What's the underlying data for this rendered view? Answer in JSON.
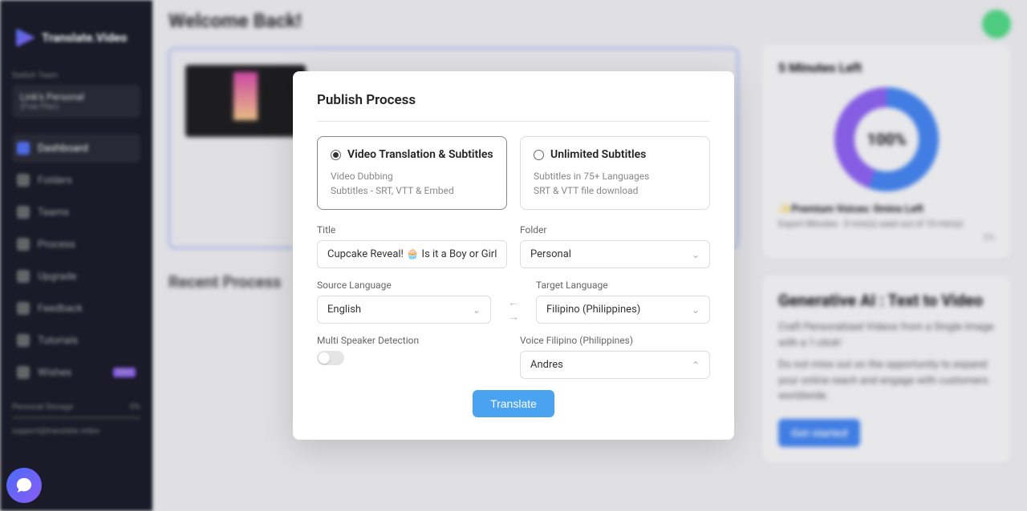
{
  "app": {
    "name": "Translate.Video"
  },
  "sidebar": {
    "switch_label": "Switch Team",
    "team_name": "Link's Personal",
    "team_plan": "(Free Plan)",
    "nav": [
      {
        "label": "Dashboard"
      },
      {
        "label": "Folders"
      },
      {
        "label": "Teams"
      },
      {
        "label": "Process"
      },
      {
        "label": "Upgrade"
      },
      {
        "label": "Feedback"
      },
      {
        "label": "Tutorials"
      },
      {
        "label": "Wishes",
        "badge": "New"
      }
    ],
    "storage_label": "Personal Storage",
    "storage_pct": "0%",
    "email": "support@translate.video"
  },
  "main": {
    "welcome": "Welcome Back!",
    "recent": "Recent Process"
  },
  "right": {
    "minutes_title": "5 Minutes Left",
    "donut_label": "100%",
    "premium": "✨Premium Voices: 0mins Left",
    "export": "Export Minutes : 0 min(s) used out of 10 min(s)",
    "pct": "0%",
    "gen_title": "Generative AI : Text to Video",
    "gen_p1": "Craft Personalized Videos from a Single Image with a 1-click!",
    "gen_p2": "Do not miss out on the opportunity to expand your online reach and engage with customers worldwide.",
    "gen_btn": "Get started"
  },
  "modal": {
    "title": "Publish Process",
    "opt1": {
      "title": "Video Translation & Subtitles",
      "line1": "Video Dubbing",
      "line2": "Subtitles - SRT, VTT & Embed"
    },
    "opt2": {
      "title": "Unlimited Subtitles",
      "line1": "Subtitles in 75+ Languages",
      "line2": "SRT & VTT file download"
    },
    "title_label": "Title",
    "title_value": "Cupcake Reveal! 🧁 Is it a Boy or Girl_ #t",
    "folder_label": "Folder",
    "folder_value": "Personal",
    "source_label": "Source Language",
    "source_value": "English",
    "target_label": "Target Language",
    "target_value": "Filipino (Philippines)",
    "multi_label": "Multi Speaker Detection",
    "voice_label": "Voice Filipino (Philippines)",
    "voice_value": "Andres",
    "translate_btn": "Translate"
  }
}
